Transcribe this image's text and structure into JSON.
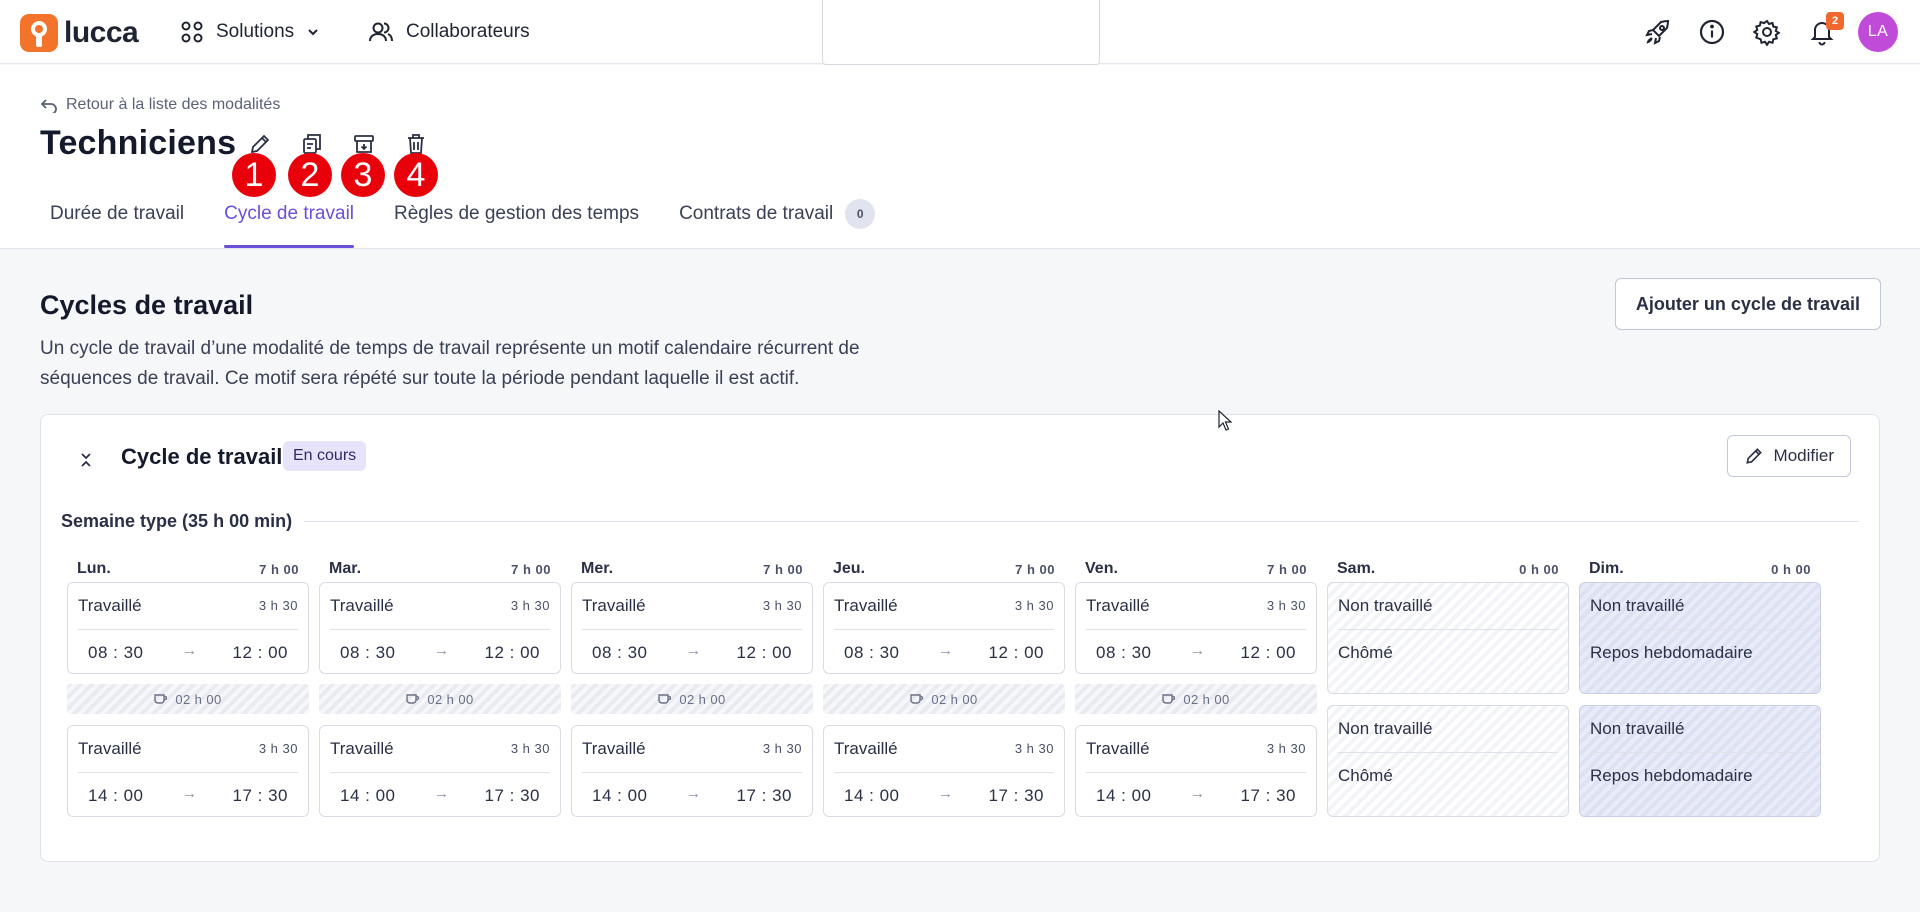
{
  "topbar": {
    "logo_text": "lucca",
    "solutions_label": "Solutions",
    "collaborateurs_label": "Collaborateurs",
    "notifications_count": "2",
    "avatar_initials": "LA"
  },
  "header": {
    "back_link": "Retour à la liste des modalités",
    "title": "Techniciens",
    "markers": [
      "1",
      "2",
      "3",
      "4"
    ]
  },
  "tabs": [
    {
      "label": "Durée de travail",
      "active": false
    },
    {
      "label": "Cycle de travail",
      "active": true
    },
    {
      "label": "Règles de gestion des temps",
      "active": false
    },
    {
      "label": "Contrats de travail",
      "active": false,
      "count": "0"
    }
  ],
  "section": {
    "title": "Cycles de travail",
    "description": "Un cycle de travail d’une modalité de temps de travail représente un motif calendaire récurrent de séquences de travail. Ce motif sera répété sur toute la période pendant laquelle il est actif.",
    "add_button": "Ajouter un cycle de travail"
  },
  "cycle": {
    "title": "Cycle de travail",
    "status": "En cours",
    "edit_button": "Modifier",
    "week_label": "Semaine type   (35 h 00 min)",
    "days": [
      {
        "name": "Lun.",
        "total": "7 h 00",
        "am": {
          "label": "Travaillé",
          "dur": "3 h 30",
          "start": "08 : 30",
          "end": "12 : 00"
        },
        "pause": "02 h 00",
        "pm": {
          "label": "Travaillé",
          "dur": "3 h 30",
          "start": "14 : 00",
          "end": "17 : 30"
        }
      },
      {
        "name": "Mar.",
        "total": "7 h 00",
        "am": {
          "label": "Travaillé",
          "dur": "3 h 30",
          "start": "08 : 30",
          "end": "12 : 00"
        },
        "pause": "02 h 00",
        "pm": {
          "label": "Travaillé",
          "dur": "3 h 30",
          "start": "14 : 00",
          "end": "17 : 30"
        }
      },
      {
        "name": "Mer.",
        "total": "7 h 00",
        "am": {
          "label": "Travaillé",
          "dur": "3 h 30",
          "start": "08 : 30",
          "end": "12 : 00"
        },
        "pause": "02 h 00",
        "pm": {
          "label": "Travaillé",
          "dur": "3 h 30",
          "start": "14 : 00",
          "end": "17 : 30"
        }
      },
      {
        "name": "Jeu.",
        "total": "7 h 00",
        "am": {
          "label": "Travaillé",
          "dur": "3 h 30",
          "start": "08 : 30",
          "end": "12 : 00"
        },
        "pause": "02 h 00",
        "pm": {
          "label": "Travaillé",
          "dur": "3 h 30",
          "start": "14 : 00",
          "end": "17 : 30"
        }
      },
      {
        "name": "Ven.",
        "total": "7 h 00",
        "am": {
          "label": "Travaillé",
          "dur": "3 h 30",
          "start": "08 : 30",
          "end": "12 : 00"
        },
        "pause": "02 h 00",
        "pm": {
          "label": "Travaillé",
          "dur": "3 h 30",
          "start": "14 : 00",
          "end": "17 : 30"
        }
      },
      {
        "name": "Sam.",
        "total": "0 h 00",
        "am": {
          "label": "Non travaillé",
          "sub": "Chômé"
        },
        "pm": {
          "label": "Non travaillé",
          "sub": "Chômé"
        }
      },
      {
        "name": "Dim.",
        "total": "0 h 00",
        "am": {
          "label": "Non travaillé",
          "sub": "Repos hebdomadaire"
        },
        "pm": {
          "label": "Non travaillé",
          "sub": "Repos hebdomadaire"
        }
      }
    ]
  },
  "colors": {
    "accent": "#6a4fd7",
    "brand": "#f4732b",
    "marker": "#e8000b",
    "avatar": "#c04bd8"
  }
}
